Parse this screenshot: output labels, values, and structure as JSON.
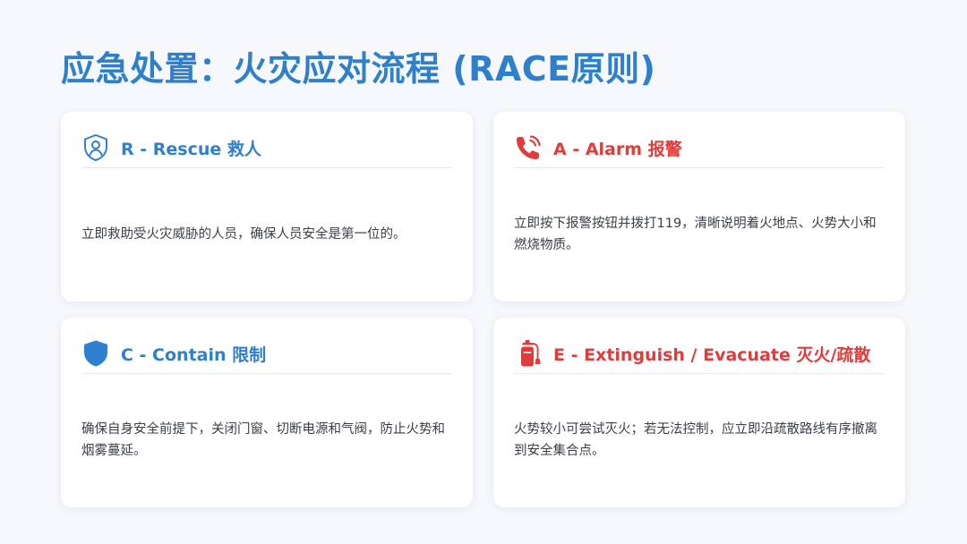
{
  "title": "应急处置：火灾应对流程 (RACE原则)",
  "colors": {
    "primary_blue": "#2f80cc",
    "alert_red": "#e03c3c"
  },
  "cards": [
    {
      "letter": "R",
      "title": "R - Rescue 救人",
      "icon": "rescue-person-shield-icon",
      "description": "立即救助受火灾威胁的人员，确保人员安全是第一位的。"
    },
    {
      "letter": "A",
      "title": "A - Alarm 报警",
      "icon": "phone-alarm-icon",
      "description": "立即按下报警按钮并拨打119，清晰说明着火地点、火势大小和燃烧物质。"
    },
    {
      "letter": "C",
      "title": "C - Contain 限制",
      "icon": "shield-icon",
      "description": "确保自身安全前提下，关闭门窗、切断电源和气阀，防止火势和烟雾蔓延。"
    },
    {
      "letter": "E",
      "title": "E - Extinguish / Evacuate 灭火/疏散",
      "icon": "fire-extinguisher-icon",
      "description": "火势较小可尝试灭火；若无法控制，应立即沿疏散路线有序撤离到安全集合点。"
    }
  ]
}
